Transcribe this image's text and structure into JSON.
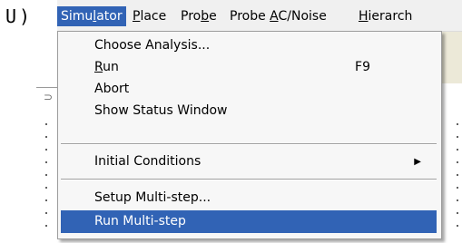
{
  "prefix": "U)",
  "menubar": {
    "items": [
      {
        "pre": "Simu",
        "u": "l",
        "post": "ator"
      },
      {
        "pre": "",
        "u": "P",
        "post": "lace"
      },
      {
        "pre": "Pro",
        "u": "b",
        "post": "e"
      },
      {
        "pre": "Probe ",
        "u": "A",
        "post": "C/Noise"
      },
      {
        "pre": "",
        "u": "H",
        "post": "ierarch"
      }
    ]
  },
  "menu": {
    "items": [
      {
        "label": "Choose Analysis..."
      },
      {
        "label_u": "R",
        "label_rest": "un",
        "shortcut": "F9"
      },
      {
        "label": "Abort"
      },
      {
        "label": "Show Status Window"
      },
      {
        "label": "Initial Conditions",
        "submenu_icon": "submenu-arrow-right"
      },
      {
        "label": "Setup Multi-step..."
      },
      {
        "label": "Run Multi-step"
      }
    ]
  },
  "colors": {
    "highlight": "#3163b5",
    "menu_bg": "#f7f7f7",
    "menubar_bg": "#f0f0f0"
  }
}
